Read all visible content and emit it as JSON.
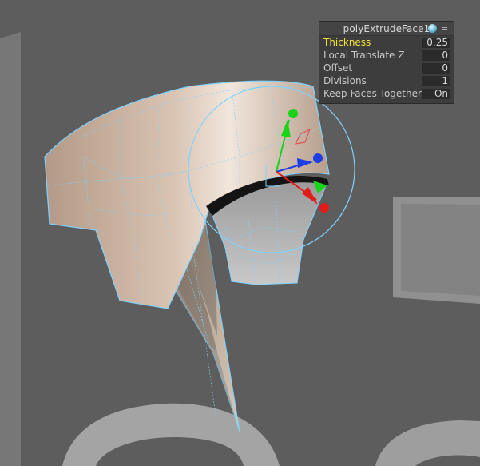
{
  "panel": {
    "title": "polyExtrudeFace1",
    "header_icons": [
      "sphere-icon",
      "menu-icon"
    ],
    "rows": [
      {
        "label": "Thickness",
        "value": "0.25",
        "active": true
      },
      {
        "label": "Local Translate Z",
        "value": "0"
      },
      {
        "label": "Offset",
        "value": "0"
      },
      {
        "label": "Divisions",
        "value": "1"
      },
      {
        "label": "Keep Faces Together",
        "value": "On"
      }
    ]
  },
  "colors": {
    "viewport_bg": "#5d5d5d",
    "wireframe": "#7fd3ff",
    "highlight_label": "#f3e23a",
    "axis_x": "#e21b1b",
    "axis_y": "#18d418",
    "axis_z": "#1d3de6"
  },
  "gizmo": {
    "icons": [
      "manipulator-sphere-icon",
      "y-axis-handle-icon",
      "z-axis-handle-icon",
      "x-axis-handle-icon"
    ]
  }
}
